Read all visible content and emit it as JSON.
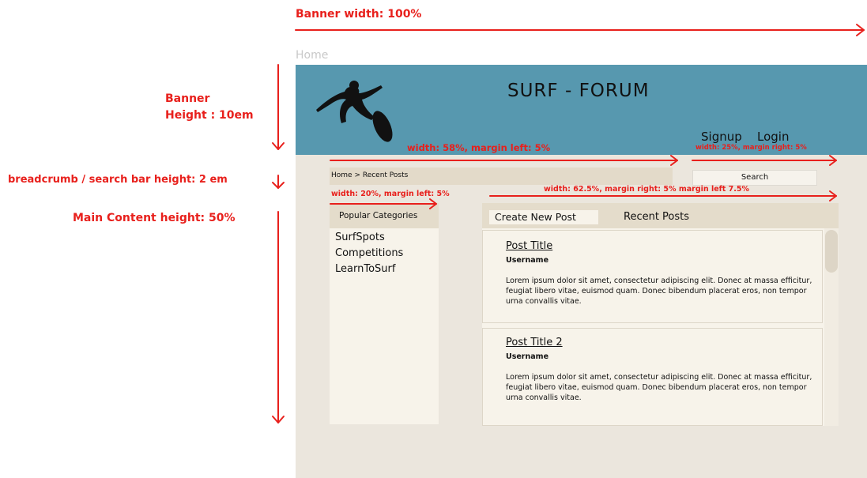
{
  "annotations": {
    "banner_width": "Banner width: 100%",
    "banner_height_line1": "Banner",
    "banner_height_line2": "Height : 10em",
    "breadcrumb_height": "breadcrumb / search bar height: 2 em",
    "main_content_height": "Main Content height: 50%",
    "breadcrumb_width": "width: 58%, margin left: 5%",
    "nav_width": "width: 25%, margin right: 5%",
    "sidebar_width": "width: 20%, margin left: 5%",
    "main_width": "width: 62.5%, margin right: 5% margin left 7.5%"
  },
  "mockup": {
    "home_label": "Home",
    "site_title": "SURF - FORUM",
    "nav": {
      "signup": "Signup",
      "login": "Login"
    },
    "breadcrumb": "Home > Recent Posts",
    "search_label": "Search",
    "categories": {
      "header": "Popular Categories",
      "items": [
        "SurfSpots",
        "Competitions",
        "LearnToSurf"
      ]
    },
    "main": {
      "create_button": "Create New Post",
      "recent_label": "Recent Posts",
      "posts": [
        {
          "title": "Post Title",
          "username": "Username",
          "body": "Lorem ipsum dolor sit amet, consectetur adipiscing elit. Donec at massa efficitur, feugiat libero vitae, euismod quam. Donec bibendum placerat eros, non tempor urna convallis vitae."
        },
        {
          "title": "Post Title 2",
          "username": "Username",
          "body": "Lorem ipsum dolor sit amet, consectetur adipiscing elit. Donec at massa efficitur, feugiat libero vitae, euismod quam. Donec bibendum placerat eros, non tempor urna convallis vitae."
        }
      ]
    }
  },
  "colors": {
    "annotation": "#e8201c",
    "banner": "#5798af",
    "canvas": "#ebe6dd",
    "panel_header": "#e4dccb",
    "panel": "#f7f3ea"
  },
  "icons": [
    "surfer-icon",
    "arrow-right-icon",
    "arrow-down-icon"
  ]
}
